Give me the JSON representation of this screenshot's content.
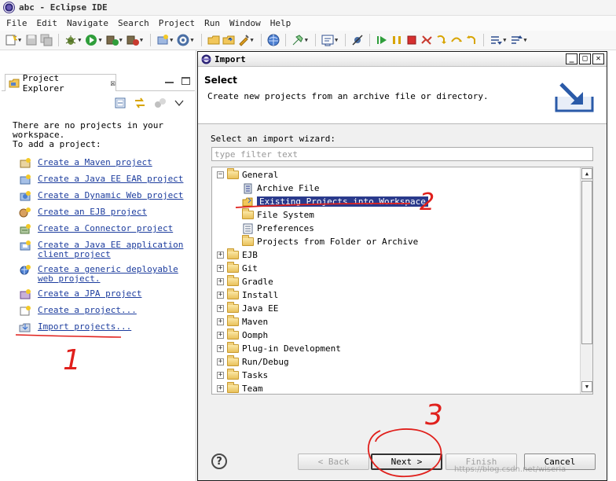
{
  "window": {
    "title": "abc - Eclipse IDE"
  },
  "menu": [
    "File",
    "Edit",
    "Navigate",
    "Search",
    "Project",
    "Run",
    "Window",
    "Help"
  ],
  "explorer": {
    "tab_label": "Project Explorer",
    "tab_close": "☒",
    "message": [
      "There are no projects in your",
      "workspace.",
      "To add a project:"
    ],
    "links": [
      "Create a Maven project",
      "Create a Java EE EAR project",
      "Create a Dynamic Web project",
      "Create an EJB project",
      "Create a Connector project",
      "Create a Java EE application client project",
      "Create a generic deployable web project.",
      "Create a JPA project",
      "Create a project...",
      "Import projects..."
    ]
  },
  "dialog": {
    "title": "Import",
    "heading": "Select",
    "description": "Create new projects from an archive file or directory.",
    "filter_label": "Select an import wizard:",
    "filter_placeholder": "type filter text",
    "tree": {
      "general": "General",
      "general_children": [
        "Archive File",
        "Existing Projects into Workspace",
        "File System",
        "Preferences",
        "Projects from Folder or Archive"
      ],
      "other_categories": [
        "EJB",
        "Git",
        "Gradle",
        "Install",
        "Java EE",
        "Maven",
        "Oomph",
        "Plug-in Development",
        "Run/Debug",
        "Tasks",
        "Team"
      ],
      "selected": "Existing Projects into Workspace"
    },
    "help_symbol": "?",
    "buttons": {
      "back": "< Back",
      "next": "Next >",
      "finish": "Finish",
      "cancel": "Cancel"
    }
  },
  "annotations": {
    "step1": "1",
    "step2": "2",
    "step3": "3"
  },
  "watermark": "https://blog.csdn.net/wiseria",
  "colors": {
    "annotation": "#e0201c",
    "selection": "#2a3a8c",
    "link": "#1d3d9e"
  }
}
